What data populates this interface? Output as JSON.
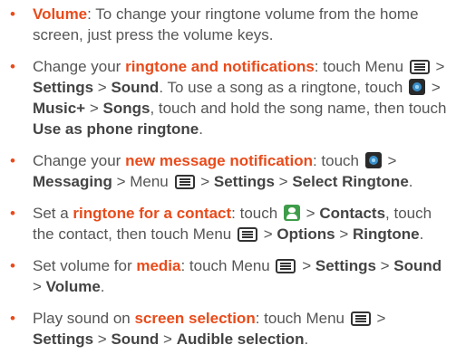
{
  "bullet_glyph": "•",
  "highlight_color": "#e94b1b",
  "icons": {
    "menu": "menu-icon",
    "music": "music-app-icon",
    "contacts": "contacts-app-icon"
  },
  "tips": [
    {
      "highlight": "Volume",
      "t1": ": To change your ringtone volume from the home screen, just press the volume keys."
    },
    {
      "t1": "Change your ",
      "highlight": "ringtone and notifications",
      "t2": ": touch Menu",
      "t3": " > ",
      "b1": "Settings",
      "t4": " > ",
      "b2": "Sound",
      "t5": ". To use a song as a ringtone, touch",
      "t6": " > ",
      "b3": "Music+",
      "t7": " > ",
      "b4": "Songs",
      "t8": ", touch and hold the song name, then touch ",
      "b5": "Use as phone ringtone",
      "t9": "."
    },
    {
      "t1": "Change your ",
      "highlight": "new message notification",
      "t2": ": touch",
      "t3": " > ",
      "b1": "Messaging",
      "t4": " > Menu",
      "t5": " > ",
      "b2": "Settings",
      "t6": " > ",
      "b3": "Select Ringtone",
      "t7": "."
    },
    {
      "t1": "Set a ",
      "highlight": "ringtone for a contact",
      "t2": ": touch",
      "t3": " > ",
      "b1": "Contacts",
      "t4": ", touch the contact, then touch Menu",
      "t5": " > ",
      "b2": "Options",
      "t6": " > ",
      "b3": "Ringtone",
      "t7": "."
    },
    {
      "t1": "Set volume for ",
      "highlight": "media",
      "t2": ": touch Menu",
      "t3": " > ",
      "b1": "Settings",
      "t4": " > ",
      "b2": "Sound",
      "t5": " > ",
      "b3": "Volume",
      "t6": "."
    },
    {
      "t1": "Play sound on ",
      "highlight": "screen selection",
      "t2": ": touch Menu",
      "t3": " > ",
      "b1": "Settings",
      "t4": " > ",
      "b2": "Sound",
      "t5": " > ",
      "b3": "Audible selection",
      "t6": "."
    }
  ]
}
